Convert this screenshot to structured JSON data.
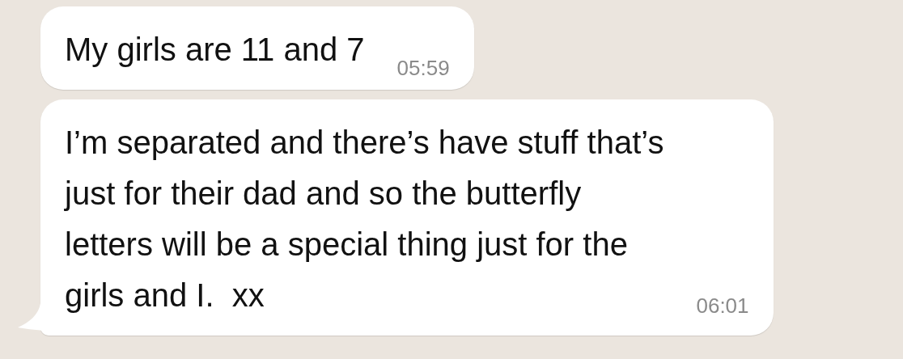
{
  "messages": [
    {
      "text": "My girls are 11 and 7",
      "time": "05:59",
      "tail": false
    },
    {
      "text": "I’m separated and there’s have stuff that’s\njust for their dad and so the butterfly\nletters will be a special thing just for the\ngirls and I.  xx",
      "time": "06:01",
      "tail": true
    }
  ]
}
